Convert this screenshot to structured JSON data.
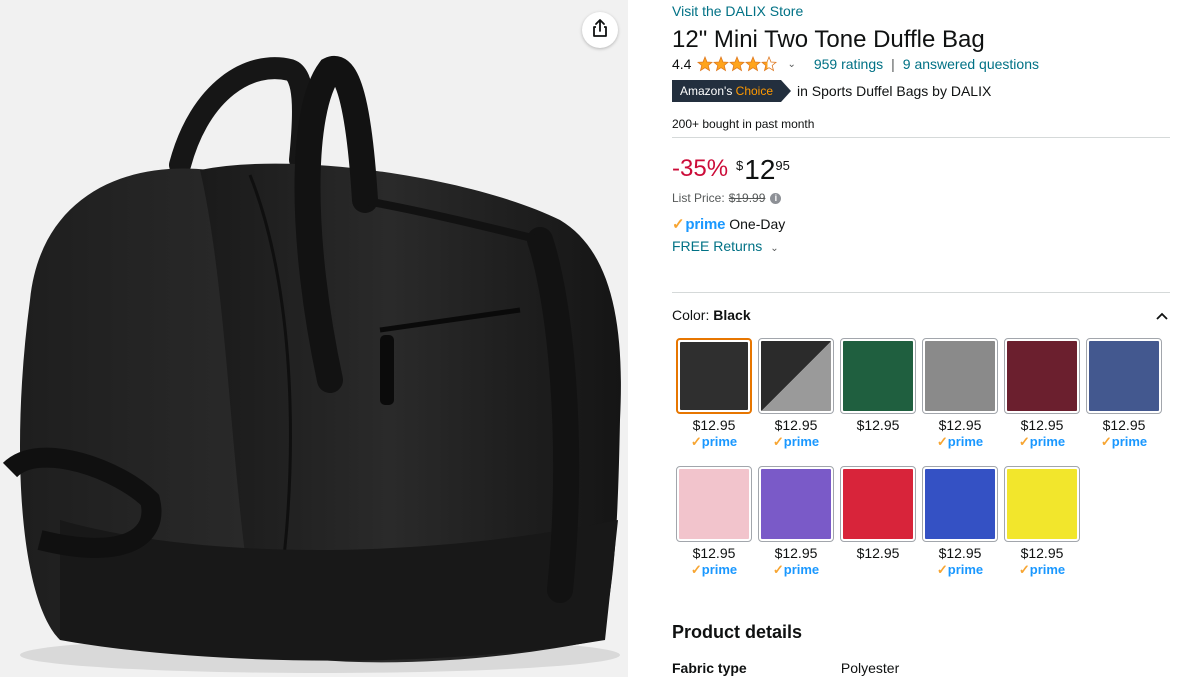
{
  "store_link": "Visit the DALIX Store",
  "title": "12\" Mini Two Tone Duffle Bag",
  "rating": {
    "value": "4.4",
    "stars": 4.4,
    "ratings_text": "959 ratings",
    "questions_text": "9 answered questions"
  },
  "badge": {
    "prefix": "Amazon's",
    "choice": "Choice",
    "category_text": "in Sports Duffel Bags by DALIX"
  },
  "bought_text": "200+ bought in past month",
  "price": {
    "discount": "-35%",
    "currency": "$",
    "whole": "12",
    "fraction": "95"
  },
  "list_price": {
    "label": "List Price:",
    "value": "$19.99"
  },
  "delivery": {
    "prime_label": "prime",
    "speed": "One-Day",
    "returns_label": "FREE Returns"
  },
  "color": {
    "label": "Color:",
    "selected": "Black"
  },
  "swatches": [
    {
      "color": "#2f2f2f",
      "price": "$12.95",
      "prime": "prime",
      "selected": true
    },
    {
      "color": "#2b2b2b",
      "color2": "#9a9a9a",
      "price": "$12.95",
      "prime": "prime"
    },
    {
      "color": "#1f5f3f",
      "price": "$12.95",
      "prime": ""
    },
    {
      "color": "#8a8a8a",
      "price": "$12.95",
      "prime": "prime"
    },
    {
      "color": "#6b1f2e",
      "price": "$12.95",
      "prime": "prime"
    },
    {
      "color": "#43588f",
      "price": "$12.95",
      "prime": "prime"
    },
    {
      "color": "#f2c4cc",
      "price": "$12.95",
      "prime": "prime"
    },
    {
      "color": "#7a5ac8",
      "price": "$12.95",
      "prime": "prime"
    },
    {
      "color": "#d8243a",
      "price": "$12.95",
      "prime": ""
    },
    {
      "color": "#3451c4",
      "price": "$12.95",
      "prime": "prime"
    },
    {
      "color": "#f2e62c",
      "price": "$12.95",
      "prime": "prime"
    }
  ],
  "details": {
    "title": "Product details",
    "rows": [
      {
        "key": "Fabric type",
        "value": "Polyester"
      }
    ]
  },
  "colors": {
    "link": "#007185",
    "deal_red": "#cc0c39",
    "prime_blue": "#1a98ff",
    "star": "#ffa41c",
    "selected_border": "#e77600"
  },
  "icons": {
    "share": "share-icon",
    "info": "info-icon",
    "collapse": "chevron-up-icon"
  }
}
